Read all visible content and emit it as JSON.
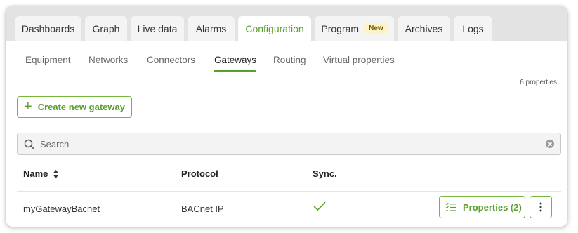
{
  "tabs": {
    "dashboards": "Dashboards",
    "graph": "Graph",
    "live_data": "Live data",
    "alarms": "Alarms",
    "configuration": "Configuration",
    "program": "Program",
    "program_badge": "New",
    "archives": "Archives",
    "logs": "Logs",
    "active": "Configuration"
  },
  "subtabs": {
    "equipment": "Equipment",
    "networks": "Networks",
    "connectors": "Connectors",
    "gateways": "Gateways",
    "routing": "Routing",
    "virtual_properties": "Virtual properties",
    "active": "Gateways"
  },
  "properties_count": "6 properties",
  "create_button": {
    "label": "Create new gateway",
    "icon": "plus-icon"
  },
  "search": {
    "placeholder": "Search",
    "value": ""
  },
  "table": {
    "columns": {
      "name": "Name",
      "protocol": "Protocol",
      "sync": "Sync."
    },
    "rows": [
      {
        "name": "myGatewayBacnet",
        "protocol": "BACnet IP",
        "sync_icon": "checkmark-icon",
        "properties_label": "Properties (2)"
      }
    ]
  },
  "colors": {
    "accent": "#5aa02c",
    "tabbar_bg": "#e3e3e3",
    "badge_bg": "#fdf4c6"
  }
}
